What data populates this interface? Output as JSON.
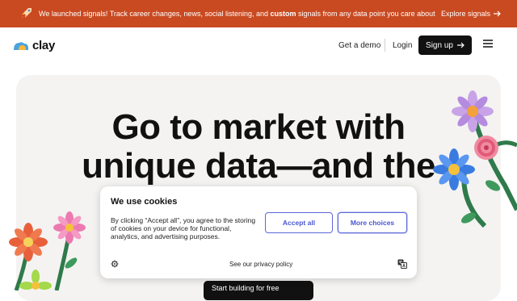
{
  "announcement": {
    "text_before": "We launched signals! Track career changes, news, social listening, and ",
    "text_bold": "custom",
    "text_after": " signals from any data point you care about",
    "link": "Explore signals"
  },
  "nav": {
    "logo_text": "clay",
    "demo": "Get a demo",
    "login": "Login",
    "signup": "Sign up"
  },
  "hero": {
    "headline_line1": "Go to market with",
    "headline_line2": "unique data—and the",
    "cta": "Start building for free"
  },
  "cookie": {
    "title": "We use cookies",
    "body": "By clicking “Accept all”, you agree to the storing of cookies on your device for functional, analytics, and advertising purposes.",
    "accept": "Accept all",
    "more": "More choices",
    "privacy": "See our privacy policy"
  },
  "colors": {
    "announcement_bg": "#c94a21",
    "hero_bg": "#f4f3f1",
    "button_accent": "#5b68d8"
  },
  "icons": [
    "rocket-icon",
    "arrow-right-icon",
    "hamburger-menu-icon",
    "gear-icon",
    "language-icon"
  ]
}
